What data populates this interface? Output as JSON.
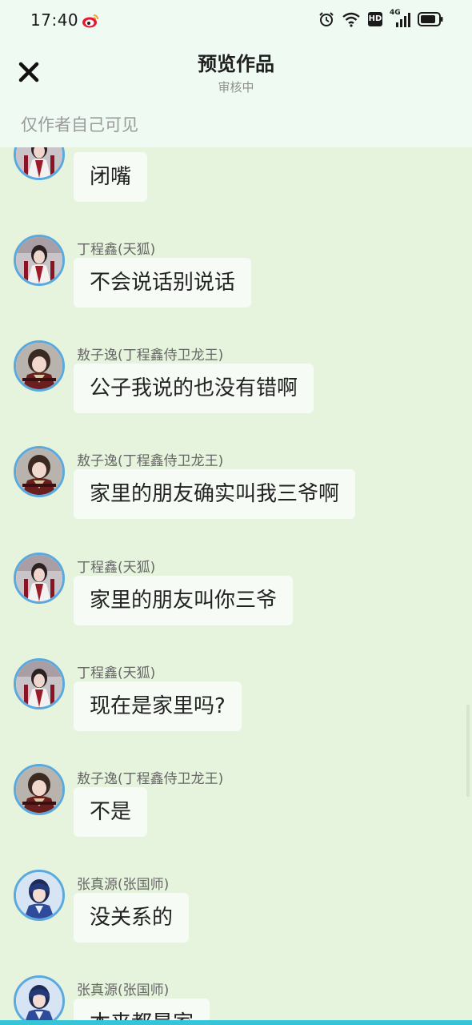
{
  "status_bar": {
    "time": "17:40",
    "icons": [
      "weibo-icon",
      "alarm-icon",
      "wifi-icon",
      "hd-icon",
      "signal-4g-icon",
      "battery-icon"
    ],
    "network_label": "4G",
    "hd_label": "HD"
  },
  "header": {
    "title": "预览作品",
    "subtitle": "审核中",
    "close_icon": "close-icon"
  },
  "visibility_note": "仅作者自己可见",
  "colors": {
    "top_bg": "#effaf3",
    "chat_bg": "#e6f3dd",
    "bubble_bg": "#f6fbf5",
    "avatar_ring": "#5aa9de",
    "bottom_bar": "#36c5d8"
  },
  "messages": [
    {
      "sender": "",
      "text": "闭嘴",
      "avatar": "character-a-avatar"
    },
    {
      "sender": "丁程鑫(天狐)",
      "text": "不会说话别说话",
      "avatar": "character-a-avatar"
    },
    {
      "sender": "敖子逸(丁程鑫侍卫龙王)",
      "text": "公子我说的也没有错啊",
      "avatar": "character-b-avatar"
    },
    {
      "sender": "敖子逸(丁程鑫侍卫龙王)",
      "text": "家里的朋友确实叫我三爷啊",
      "avatar": "character-b-avatar"
    },
    {
      "sender": "丁程鑫(天狐)",
      "text": "家里的朋友叫你三爷",
      "avatar": "character-a-avatar"
    },
    {
      "sender": "丁程鑫(天狐)",
      "text": "现在是家里吗?",
      "avatar": "character-a-avatar"
    },
    {
      "sender": "敖子逸(丁程鑫侍卫龙王)",
      "text": "不是",
      "avatar": "character-b-avatar"
    },
    {
      "sender": "张真源(张国师)",
      "text": "没关系的",
      "avatar": "character-c-avatar"
    },
    {
      "sender": "张真源(张国师)",
      "text": "本来都是家",
      "avatar": "character-c-avatar"
    }
  ]
}
